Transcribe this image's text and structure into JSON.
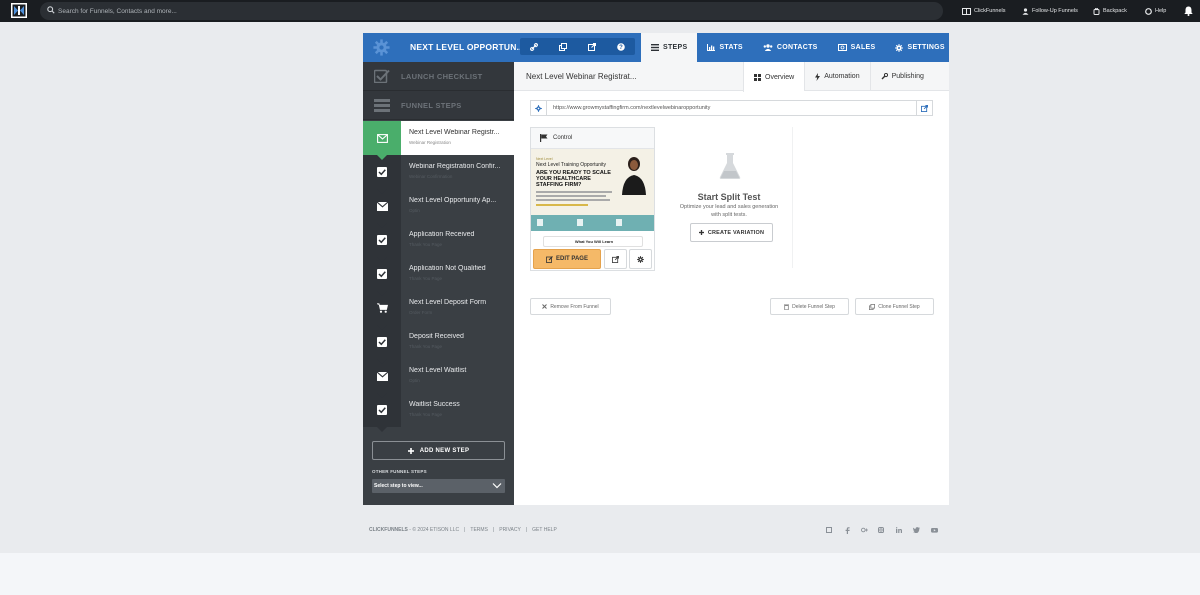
{
  "topnav": {
    "search_placeholder": "Search for Funnels, Contacts and more...",
    "links": {
      "clickfunnels": "ClickFunnels",
      "followup": "Follow-Up Funnels",
      "backpack": "Backpack",
      "help": "Help"
    }
  },
  "funnel": {
    "name": "NEXT LEVEL OPPORTUN...",
    "tabs": {
      "steps": "STEPS",
      "stats": "STATS",
      "contacts": "CONTACTS",
      "sales": "SALES",
      "settings": "SETTINGS"
    }
  },
  "sidebar": {
    "launch_checklist": "LAUNCH CHECKLIST",
    "funnel_steps": "FUNNEL STEPS",
    "steps": [
      {
        "label": "Next Level Webinar Registr...",
        "sub": "Webinar Registration",
        "icon": "envelope-icon"
      },
      {
        "label": "Webinar Registration Confir...",
        "sub": "Webinar Confirmation",
        "icon": "checkbox-icon"
      },
      {
        "label": "Next Level Opportunity Ap...",
        "sub": "Optin",
        "icon": "envelope-icon"
      },
      {
        "label": "Application Received",
        "sub": "Thank You Page",
        "icon": "checkbox-icon"
      },
      {
        "label": "Application Not Qualified",
        "sub": "Thank You Page",
        "icon": "checkbox-icon"
      },
      {
        "label": "Next Level Deposit Form",
        "sub": "Order Form",
        "icon": "cart-icon"
      },
      {
        "label": "Deposit Received",
        "sub": "Thank You Page",
        "icon": "checkbox-icon"
      },
      {
        "label": "Next Level Waitlist",
        "sub": "Optin",
        "icon": "envelope-icon"
      },
      {
        "label": "Waitlist Success",
        "sub": "Thank You Page",
        "icon": "checkbox-icon"
      }
    ],
    "add_new_step": "ADD NEW STEP",
    "other_funnel_steps": "OTHER FUNNEL STEPS",
    "select_placeholder": "Select step to view..."
  },
  "main": {
    "step_title": "Next Level Webinar Registrat...",
    "subtabs": {
      "overview": "Overview",
      "automation": "Automation",
      "publishing": "Publishing"
    },
    "url": "https://www.growmystaffingfirm.com/nextlevelwebinaropportunity",
    "variant": {
      "label": "Control",
      "thumb_kicker": "Next Level",
      "thumb_tagline": "Next Level Training Opportunity",
      "thumb_headline": "ARE YOU READY TO SCALE YOUR HEALTHCARE STAFFING FIRM?",
      "thumb_learn": "What You Will Learn",
      "edit_page": "EDIT PAGE"
    },
    "split_test": {
      "title": "Start Split Test",
      "description": "Optimize your lead and sales generation with split tests.",
      "create_variation": "CREATE VARIATION"
    },
    "actions": {
      "remove": "Remove From Funnel",
      "delete": "Delete Funnel Step",
      "clone": "Clone Funnel Step"
    }
  },
  "footer": {
    "brand": "CLICKFUNNELS",
    "copyright": "- © 2024 ETISON LLC",
    "sep": "|",
    "terms": "TERMS",
    "privacy": "PRIVACY",
    "get_help": "GET HELP"
  },
  "colors": {
    "header_blue": "#2e6fbb",
    "active_step_green": "#4aae6b",
    "edit_button_orange": "#f5b968",
    "sidebar_dark": "#3a3f44"
  }
}
